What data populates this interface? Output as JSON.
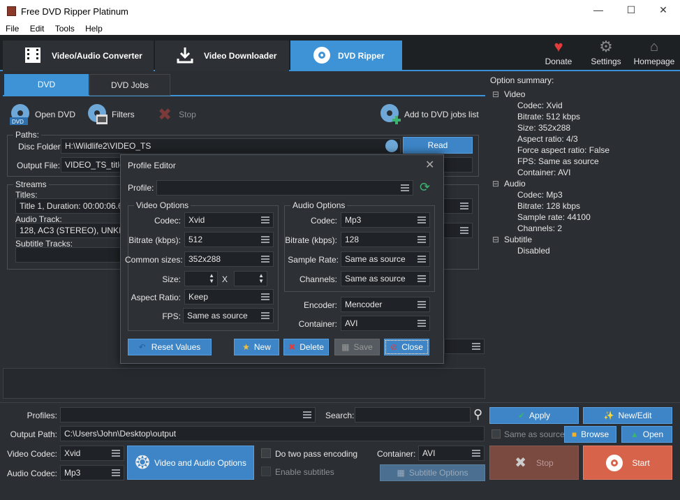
{
  "app": {
    "title": "Free DVD Ripper Platinum"
  },
  "menu": [
    "File",
    "Edit",
    "Tools",
    "Help"
  ],
  "tabs": {
    "converter": "Video/Audio Converter",
    "downloader": "Video Downloader",
    "ripper": "DVD Ripper"
  },
  "right_buttons": {
    "donate": "Donate",
    "settings": "Settings",
    "homepage": "Homepage"
  },
  "subtabs": {
    "dvd": "DVD",
    "jobs": "DVD Jobs"
  },
  "toolbar": {
    "open_dvd": "Open DVD",
    "filters": "Filters",
    "stop": "Stop",
    "add_jobs": "Add to DVD jobs list",
    "dvd_badge": "DVD"
  },
  "paths": {
    "group": "Paths:",
    "disc_label": "Disc Folder:",
    "disc_value": "H:\\Wildlife2\\VIDEO_TS",
    "read": "Read",
    "output_label": "Output File:",
    "output_value": "VIDEO_TS_title1"
  },
  "streams": {
    "group": "Streams",
    "titles_label": "Titles:",
    "titles_value": "Title 1, Duration: 00:00:06.66",
    "audio_label": "Audio Track:",
    "audio_value": "128, AC3 (STEREO), UNKNOW",
    "subtitle_label": "Subtitle Tracks:"
  },
  "dialog": {
    "title": "Profile Editor",
    "profile_label": "Profile:",
    "profile_value": "",
    "video_group": "Video Options",
    "codec_label": "Codec:",
    "codec_value": "Xvid",
    "bitrate_label": "Bitrate (kbps):",
    "bitrate_value": "512",
    "common_label": "Common sizes:",
    "common_value": "352x288",
    "size_label": "Size:",
    "size_x": "X",
    "aspect_label": "Aspect Ratio:",
    "aspect_value": "Keep",
    "fps_label": "FPS:",
    "fps_value": "Same as source",
    "audio_group": "Audio Options",
    "acodec_label": "Codec:",
    "acodec_value": "Mp3",
    "abitrate_label": "Bitrate (kbps):",
    "abitrate_value": "128",
    "samplerate_label": "Sample Rate:",
    "samplerate_value": "Same as source",
    "channels_label": "Channels:",
    "channels_value": "Same as source",
    "encoder_label": "Encoder:",
    "encoder_value": "Mencoder",
    "container_label": "Container:",
    "container_value": "AVI",
    "reset": "Reset Values",
    "new": "New",
    "delete": "Delete",
    "save": "Save",
    "close": "Close"
  },
  "option_summary": {
    "title": "Option summary:",
    "video": "Video",
    "video_items": [
      "Codec: Xvid",
      "Bitrate: 512 kbps",
      "Size: 352x288",
      "Aspect ratio: 4/3",
      "Force aspect ratio: False",
      "FPS: Same as source",
      "Container: AVI"
    ],
    "audio": "Audio",
    "audio_items": [
      "Codec: Mp3",
      "Bitrate: 128 kbps",
      "Sample rate: 44100",
      "Channels: 2"
    ],
    "subtitle": "Subtitle",
    "subtitle_items": [
      "Disabled"
    ]
  },
  "bottom": {
    "profiles_label": "Profiles:",
    "search_label": "Search:",
    "apply": "Apply",
    "new_edit": "New/Edit",
    "output_label": "Output Path:",
    "output_value": "C:\\Users\\John\\Desktop\\output",
    "same_as_source": "Same as source",
    "browse": "Browse",
    "open": "Open",
    "vcodec_label": "Video Codec:",
    "vcodec_value": "Xvid",
    "acodec_label": "Audio Codec:",
    "acodec_value": "Mp3",
    "va_options": "Video and Audio Options",
    "two_pass": "Do two pass encoding",
    "enable_subs": "Enable subtitles",
    "container_label": "Container:",
    "container_value": "AVI",
    "subtitle_options": "Subtitle Options",
    "stop": "Stop",
    "start": "Start"
  }
}
